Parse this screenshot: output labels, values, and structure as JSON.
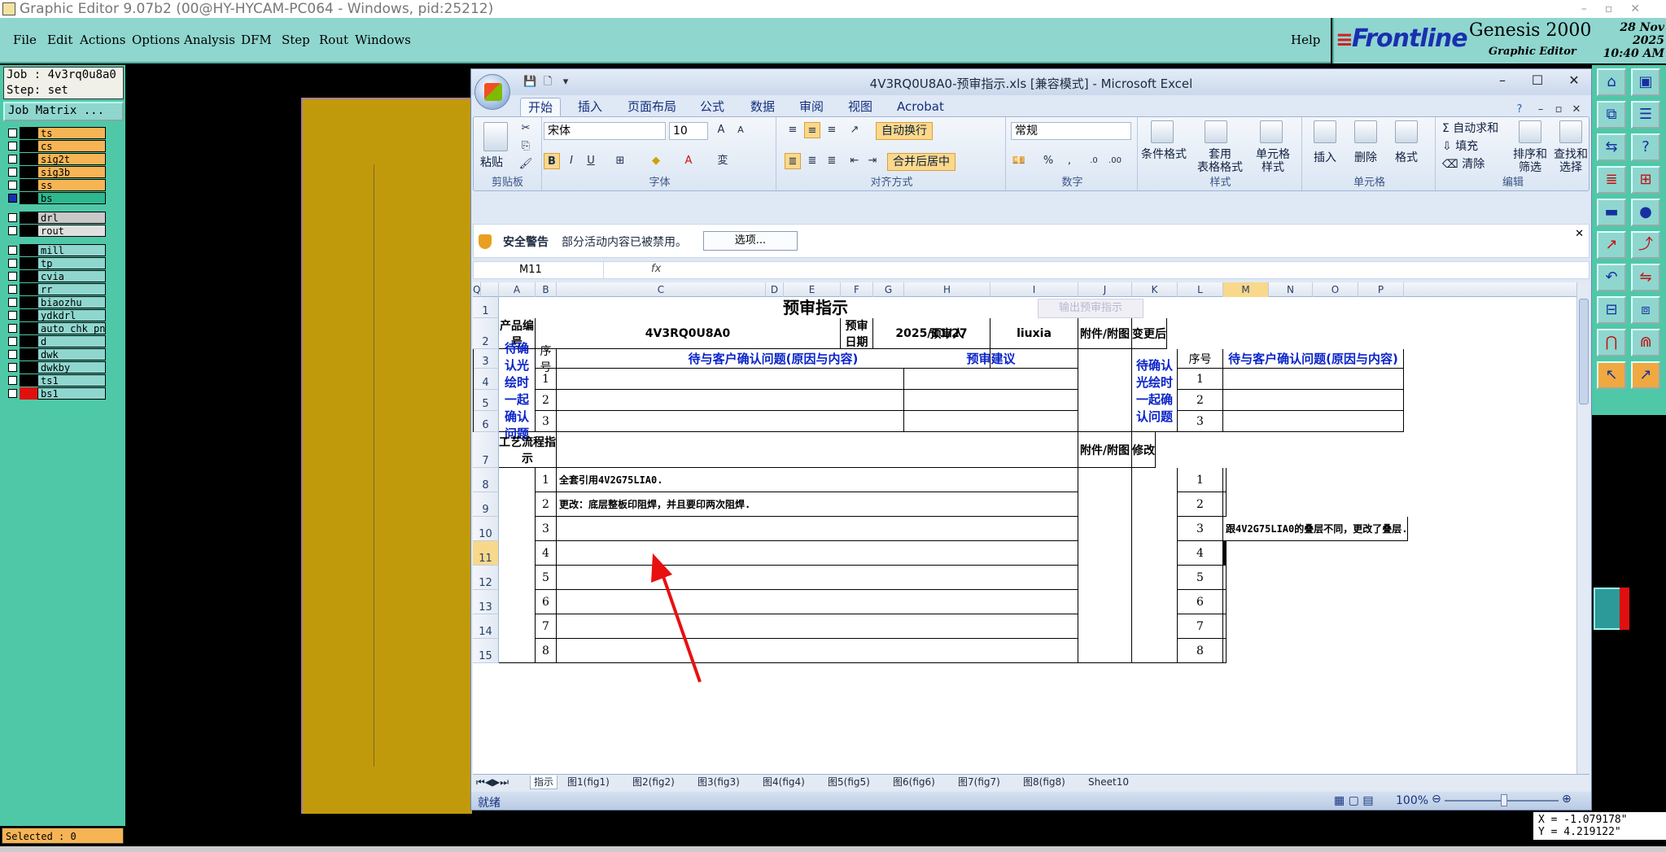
{
  "genesis": {
    "title": "Graphic Editor 9.07b2 (00@HY-HYCAM-PC064 - Windows, pid:25212)",
    "menu": [
      "File",
      "Edit",
      "Actions",
      "Options",
      "Analysis",
      "DFM",
      "Step",
      "Rout",
      "Windows"
    ],
    "help": "Help",
    "brand": "Frontline",
    "product": "Genesis 2000",
    "product_sub": "Graphic Editor",
    "date": "28 Nov 2025",
    "time": "10:40 AM",
    "job_line": "Job : 4v3rq0u8a0",
    "step_line": "Step: set",
    "job_matrix": "Job Matrix ...",
    "layers": [
      {
        "name": "ts",
        "color": "#f7b454"
      },
      {
        "name": "cs",
        "color": "#f7b454"
      },
      {
        "name": "sig2t",
        "color": "#f7b454"
      },
      {
        "name": "sig3b",
        "color": "#f7b454"
      },
      {
        "name": "ss",
        "color": "#f7b454"
      },
      {
        "name": "bs",
        "color": "#2db890"
      },
      {
        "name": "drl",
        "color": "#c8c8c8"
      },
      {
        "name": "rout",
        "color": "#e0e0e0"
      },
      {
        "name": "mill",
        "color": "#8fd6cf"
      },
      {
        "name": "tp",
        "color": "#8fd6cf"
      },
      {
        "name": "cvia",
        "color": "#8fd6cf"
      },
      {
        "name": "rr",
        "color": "#8fd6cf"
      },
      {
        "name": "biaozhu",
        "color": "#8fd6cf"
      },
      {
        "name": "ydkdrl",
        "color": "#8fd6cf"
      },
      {
        "name": "auto_chk_pn",
        "color": "#8fd6cf"
      },
      {
        "name": "d",
        "color": "#8fd6cf"
      },
      {
        "name": "dwk",
        "color": "#8fd6cf"
      },
      {
        "name": "dwkby",
        "color": "#8fd6cf"
      },
      {
        "name": "ts1",
        "color": "#8fd6cf"
      },
      {
        "name": "bs1",
        "color": "#8fd6cf"
      }
    ],
    "selected": "Selected : 0",
    "coord_x": "X = -1.079178\"",
    "coord_y": "Y =  4.219122\""
  },
  "excel": {
    "title": "4V3RQ0U8A0-预审指示.xls  [兼容模式] - Microsoft Excel",
    "tabs": [
      "开始",
      "插入",
      "页面布局",
      "公式",
      "数据",
      "审阅",
      "视图",
      "Acrobat"
    ],
    "ribbon": {
      "paste": "粘贴",
      "clipboard": "剪贴板",
      "font_name": "宋体",
      "font_size": "10",
      "font_group": "字体",
      "wrap_text": "自动换行",
      "merge_center": "合并后居中",
      "align_group": "对齐方式",
      "number_format": "常规",
      "number_group": "数字",
      "cond_format": "条件格式",
      "table_format_1": "套用",
      "table_format_2": "表格格式",
      "cell_style_1": "单元格",
      "cell_style_2": "样式",
      "styles_group": "样式",
      "insert": "插入",
      "delete": "删除",
      "format": "格式",
      "cells_group": "单元格",
      "autosum": "自动求和",
      "fill": "填充",
      "clear": "清除",
      "sort_1": "排序和",
      "sort_2": "筛选",
      "find_1": "查找和",
      "find_2": "选择",
      "edit_group": "编辑"
    },
    "security": {
      "label": "安全警告",
      "message": "部分活动内容已被禁用。",
      "options": "选项..."
    },
    "name_box": "M11",
    "fx": "fx",
    "columns": [
      "A",
      "B",
      "C",
      "D",
      "E",
      "F",
      "G",
      "H",
      "I",
      "J",
      "K",
      "L",
      "M",
      "N",
      "O",
      "P",
      "Q"
    ],
    "rows": [
      "1",
      "2",
      "3",
      "4",
      "5",
      "6",
      "7",
      "8",
      "9",
      "10",
      "11",
      "12",
      "13",
      "14",
      "15"
    ],
    "sheet": {
      "title": "预审指示",
      "export_btn": "输出预审指示",
      "product_no_label": "产品编号",
      "product_no": "4V3RQ0U8A0",
      "review_date_label": "预审日期",
      "review_date": "2025/11/27",
      "reviewer_label": "预审人",
      "reviewer": "liuxia",
      "attachment": "附件/附图",
      "after_change": "变更后",
      "seq": "序号",
      "confirm_issue": "待与客户确认问题(原因与内容)",
      "suggestion": "预审建议",
      "pending_label": "待确认光绘时一起确认问题",
      "process_label": "工艺流程指示",
      "modify": "修改",
      "nums": [
        "1",
        "2",
        "3",
        "4",
        "5",
        "6",
        "7",
        "8"
      ],
      "instr_1": "全套引用4V2G75LIA0.",
      "instr_2": "更改：底层整板印阻焊，并且要印两次阻焊.",
      "modify_3": "跟4V2G75LIA0的叠层不同，更改了叠层."
    },
    "sheet_tabs": [
      "指示",
      "图1(fig1)",
      "图2(fig2)",
      "图3(fig3)",
      "图4(fig4)",
      "图5(fig5)",
      "图6(fig6)",
      "图7(fig7)",
      "图8(fig8)",
      "Sheet10"
    ],
    "status": "就绪",
    "zoom": "100%"
  }
}
